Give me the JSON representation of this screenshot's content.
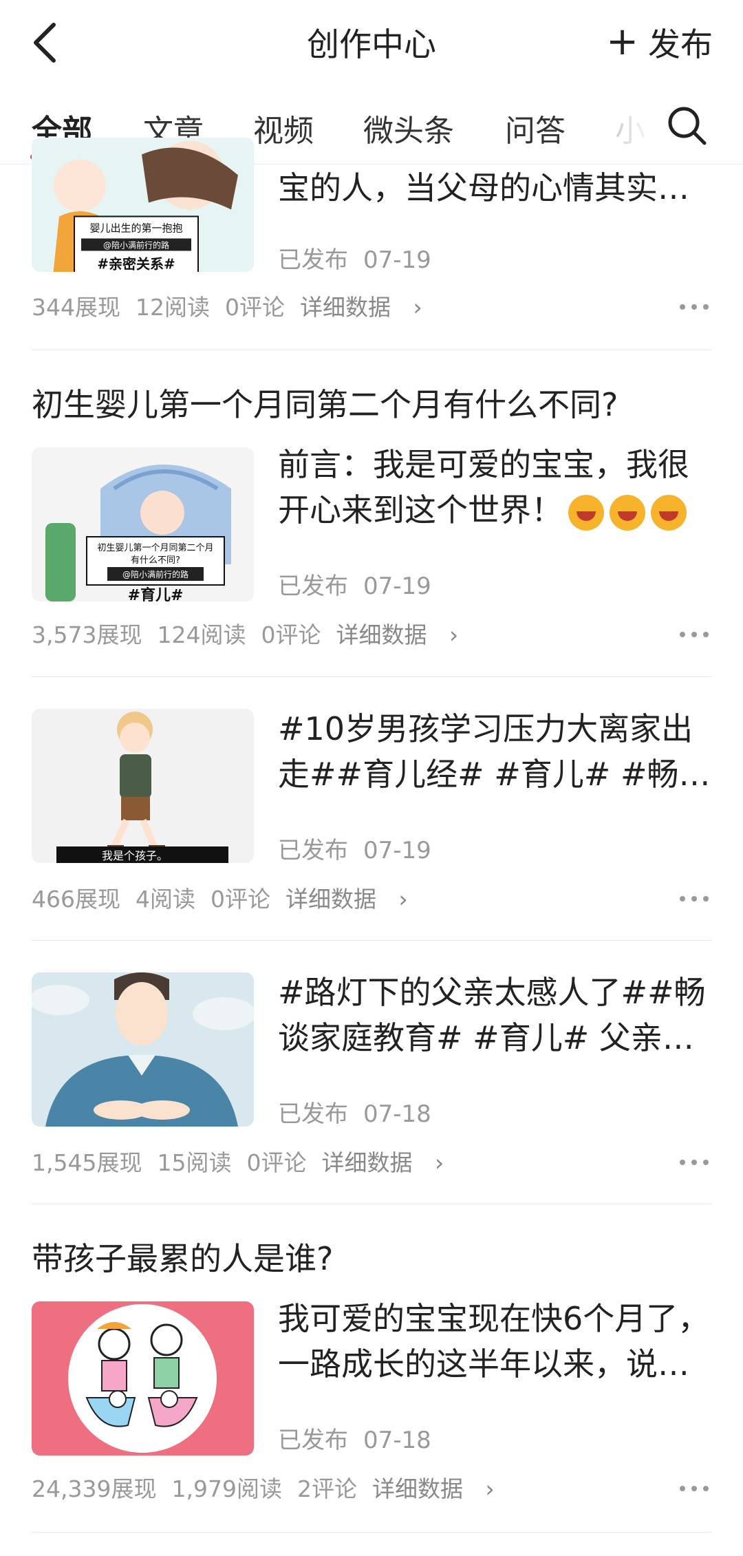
{
  "header": {
    "title": "创作中心",
    "publish_label": "发布"
  },
  "tabs": [
    "全部",
    "文章",
    "视频",
    "微头条",
    "问答",
    "小"
  ],
  "cards": [
    {
      "headline": "",
      "desc": [
        "宝的人，当父母的心情其实非…"
      ],
      "status": "已发布",
      "date": "07-19",
      "thumb_text": [
        "婴儿出生的第一抱抱",
        "@陪小满前行的路",
        "#亲密关系#"
      ],
      "stats": {
        "views": "344展现",
        "reads": "12阅读",
        "comments": "0评论",
        "detail": "详细数据"
      }
    },
    {
      "headline": "初生婴儿第一个月同第二个月有什么不同?",
      "desc": [
        "前言：我是可爱的宝宝，我很",
        "开心来到这个世界！"
      ],
      "status": "已发布",
      "date": "07-19",
      "thumb_text": [
        "初生婴儿第一个月同第二个月",
        "有什么不同?",
        "@陪小满前行的路",
        "#育儿#"
      ],
      "stats": {
        "views": "3,573展现",
        "reads": "124阅读",
        "comments": "0评论",
        "detail": "详细数据"
      }
    },
    {
      "headline": "",
      "desc": [
        "#10岁男孩学习压力大离家出",
        "走##育儿经# #育儿# #畅谈…"
      ],
      "status": "已发布",
      "date": "07-19",
      "thumb_text": [
        "我是个孩子。"
      ],
      "stats": {
        "views": "466展现",
        "reads": "4阅读",
        "comments": "0评论",
        "detail": "详细数据"
      }
    },
    {
      "headline": "",
      "desc": [
        "#路灯下的父亲太感人了##畅",
        "谈家庭教育# #育儿# 父亲…"
      ],
      "status": "已发布",
      "date": "07-18",
      "thumb_text": [],
      "stats": {
        "views": "1,545展现",
        "reads": "15阅读",
        "comments": "0评论",
        "detail": "详细数据"
      }
    },
    {
      "headline": "带孩子最累的人是谁?",
      "desc": [
        "我可爱的宝宝现在快6个月了，",
        "一路成长的这半年以来，说说…"
      ],
      "status": "已发布",
      "date": "07-18",
      "thumb_text": [],
      "stats": {
        "views": "24,339展现",
        "reads": "1,979阅读",
        "comments": "2评论",
        "detail": "详细数据"
      }
    }
  ],
  "colors": {
    "accent": "#e33e3e",
    "muted_text": "#999999"
  },
  "icons": [
    "back-arrow-icon",
    "plus-icon",
    "search-icon",
    "chevron-right-icon",
    "more-dots-icon",
    "laughing-emoji-icon"
  ]
}
